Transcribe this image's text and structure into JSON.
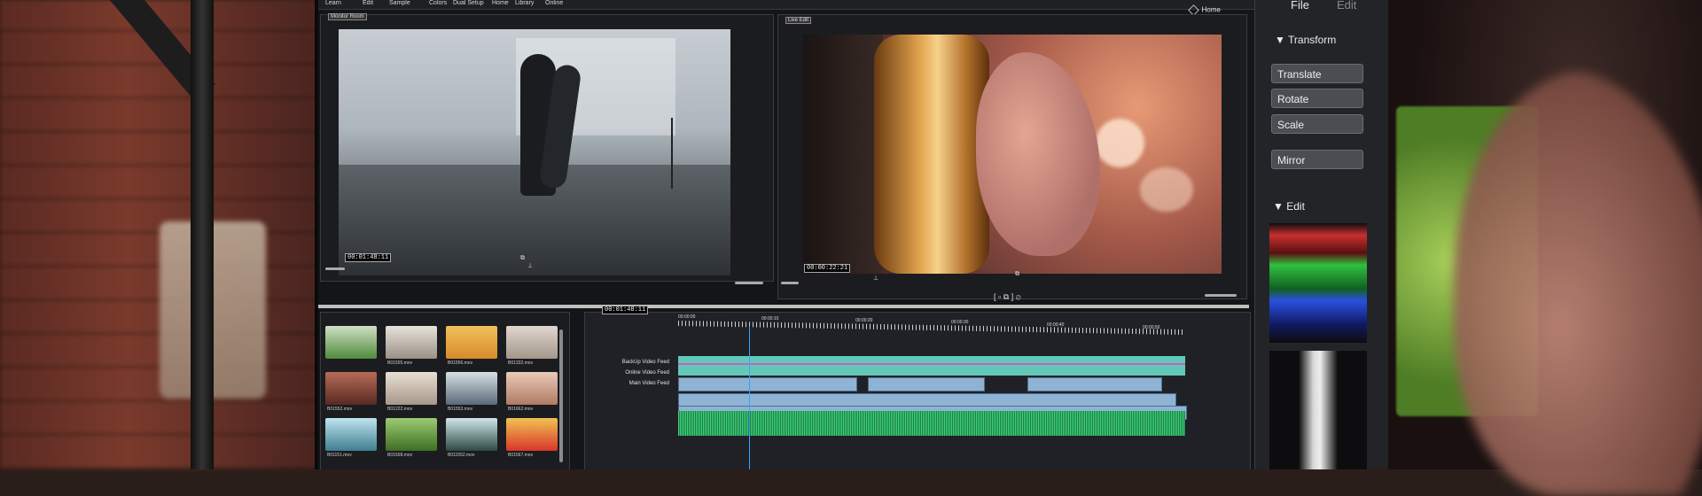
{
  "menubar": {
    "items": [
      "Learn",
      "Edit",
      "Sample",
      "Colors",
      "Dual Setup",
      "Home",
      "Library",
      "Online"
    ],
    "home_label": "Home"
  },
  "monitor": {
    "left_label": "Monitor Room",
    "right_label": "Live Edit",
    "left_timecode": "00:01:48:11",
    "right_timecode": "00:00:22:21"
  },
  "media": {
    "files": [
      "",
      "B01555.mov",
      "B01556.mov",
      "B01332.mov",
      "B01552.mov",
      "B01222.mov",
      "B01553.mov",
      "B01662.mov",
      "B01151.mov",
      "B01558.mov",
      "B011552.mov",
      "B01567.mov"
    ]
  },
  "timeline": {
    "timecode": "00:01:48:11",
    "ruler_labels": [
      "00:00:00",
      "00:00:10",
      "00:00:20",
      "00:00:30",
      "00:00:40",
      "00:00:50"
    ],
    "tracks": [
      "BackUp Video Feed",
      "Online Video Feed",
      "Main Video Feed"
    ]
  },
  "right_panel": {
    "menu": [
      "File",
      "Edit"
    ],
    "transform_title": "Transform",
    "buttons": [
      "Translate",
      "Rotate",
      "Scale",
      "Mirror"
    ],
    "edit_title": "Edit"
  },
  "colors": {
    "panel_bg": "#1b1c20",
    "clip_blue": "#8fb3d5",
    "track_teal": "#62c9b8",
    "audio_green": "#3cd67a",
    "button_gray": "#4b4d52"
  }
}
